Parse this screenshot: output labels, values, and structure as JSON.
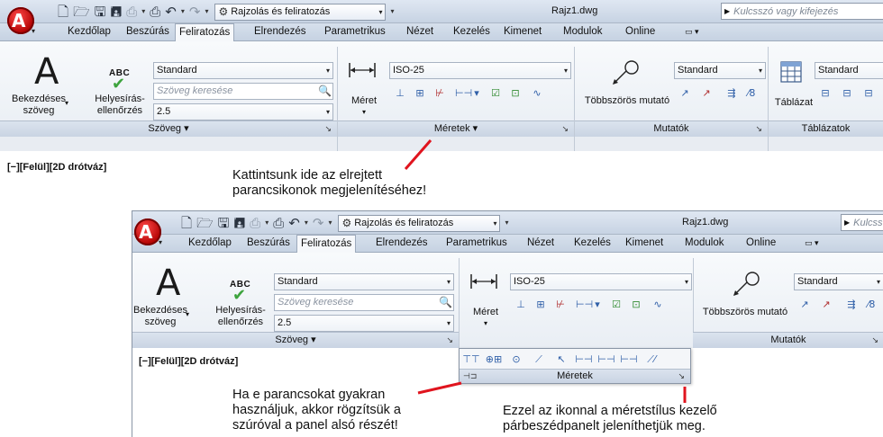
{
  "window1": {
    "title": "Rajz1.dwg",
    "workspace": "Rajzolás és feliratozás",
    "search_placeholder": "Kulcsszó vagy kifejezés",
    "app_letter": "A",
    "tabs": [
      "Kezdőlap",
      "Beszúrás",
      "Feliratozás",
      "Elrendezés",
      "Parametrikus",
      "Nézet",
      "Kezelés",
      "Kimenet",
      "Modulok",
      "Online"
    ],
    "active_tab": "Feliratozás",
    "text_panel": {
      "big_letter": "A",
      "mtext_label_1": "Bekezdéses",
      "mtext_label_2": "szöveg",
      "spell_abc": "ABC",
      "spell_label_1": "Helyesírás-",
      "spell_label_2": "ellenőrzés",
      "style_value": "Standard",
      "find_placeholder": "Szöveg keresése",
      "height_value": "2.5",
      "footer": "Szöveg ▾"
    },
    "dim_panel": {
      "button_label": "Méret",
      "style_value": "ISO-25",
      "footer": "Méretek ▾"
    },
    "leader_panel": {
      "button_label": "Többszörös mutató",
      "style_value": "Standard",
      "footer": "Mutatók"
    },
    "table_panel": {
      "button_label": "Táblázat",
      "style_value": "Standard",
      "footer": "Táblázatok"
    },
    "viewport_label": "[−][Felül][2D drótváz]"
  },
  "window2": {
    "title": "Rajz1.dwg",
    "workspace": "Rajzolás és feliratozás",
    "search_placeholder": "Kulcss",
    "app_letter": "A",
    "tabs": [
      "Kezdőlap",
      "Beszúrás",
      "Feliratozás",
      "Elrendezés",
      "Parametrikus",
      "Nézet",
      "Kezelés",
      "Kimenet",
      "Modulok",
      "Online"
    ],
    "active_tab": "Feliratozás",
    "text_panel": {
      "big_letter": "A",
      "mtext_label_1": "Bekezdéses",
      "mtext_label_2": "szöveg",
      "spell_abc": "ABC",
      "spell_label_1": "Helyesírás-",
      "spell_label_2": "ellenőrzés",
      "style_value": "Standard",
      "find_placeholder": "Szöveg keresése",
      "height_value": "2.5",
      "footer": "Szöveg ▾"
    },
    "dim_panel": {
      "button_label": "Méret",
      "style_value": "ISO-25",
      "footer": "Méretek"
    },
    "leader_panel": {
      "button_label": "Többszörös mutató",
      "style_value": "Standard",
      "footer": "Mutatók"
    },
    "viewport_label": "[−][Felül][2D drótváz]"
  },
  "callouts": {
    "top_line1": "Kattintsunk ide az elrejtett",
    "top_line2": "parancsikonok megjelenítéséhez!",
    "left_line1": "Ha e parancsokat gyakran",
    "left_line2": "használjuk, akkor rögzítsük a",
    "left_line3": "szúróval a panel alsó részét!",
    "right_line1": "Ezzel az ikonnal a méretstílus kezelő",
    "right_line2": "párbeszédpanelt jeleníthetjük meg."
  },
  "colors": {
    "callout_arrow": "#e0141e",
    "app_button": "#c00000",
    "check": "#3da33d"
  }
}
